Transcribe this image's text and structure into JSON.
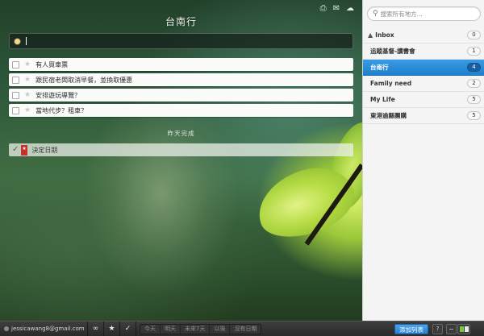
{
  "header": {
    "list_title": "台南行",
    "icons": [
      "print-icon",
      "mail-icon",
      "cloud-sync-icon"
    ]
  },
  "add_task": {
    "value": "|"
  },
  "tasks": [
    {
      "text": "有人買車票",
      "starred": false,
      "done": false
    },
    {
      "text": "跟民宿老闆取消早餐，並換取優惠",
      "starred": false,
      "done": false
    },
    {
      "text": "安排遊玩導覽？",
      "starred": false,
      "done": false
    },
    {
      "text": "當地代步？租車？",
      "starred": false,
      "done": false
    }
  ],
  "completed": {
    "heading": "昨天完成",
    "tasks": [
      {
        "text": "決定日期",
        "done": true,
        "starred": true
      }
    ]
  },
  "sidebar": {
    "search_placeholder": "搜索所有地方...",
    "lists": [
      {
        "name": "Inbox",
        "count": "0",
        "icon": "inbox-icon",
        "active": false
      },
      {
        "name": "追蹤基督-讀書會",
        "count": "1",
        "active": false
      },
      {
        "name": "台南行",
        "count": "4",
        "active": true
      },
      {
        "name": "Family need",
        "count": "2",
        "active": false
      },
      {
        "name": "My Life",
        "count": "5",
        "active": false
      },
      {
        "name": "東港逾縣團購",
        "count": "5",
        "active": false
      }
    ]
  },
  "bottom_bar": {
    "email": "jessicawang8@gmail.com",
    "filter_icons": [
      "infinity-icon",
      "star-icon",
      "check-icon"
    ],
    "date_filters": [
      "今天",
      "明天",
      "未來7天",
      "以後",
      "沒有日期"
    ],
    "add_list_label": "添加列表",
    "help_label": "?",
    "minus_label": "−"
  },
  "colors": {
    "accent": "#2384d4",
    "completed_ribbon": "#c9302c"
  }
}
